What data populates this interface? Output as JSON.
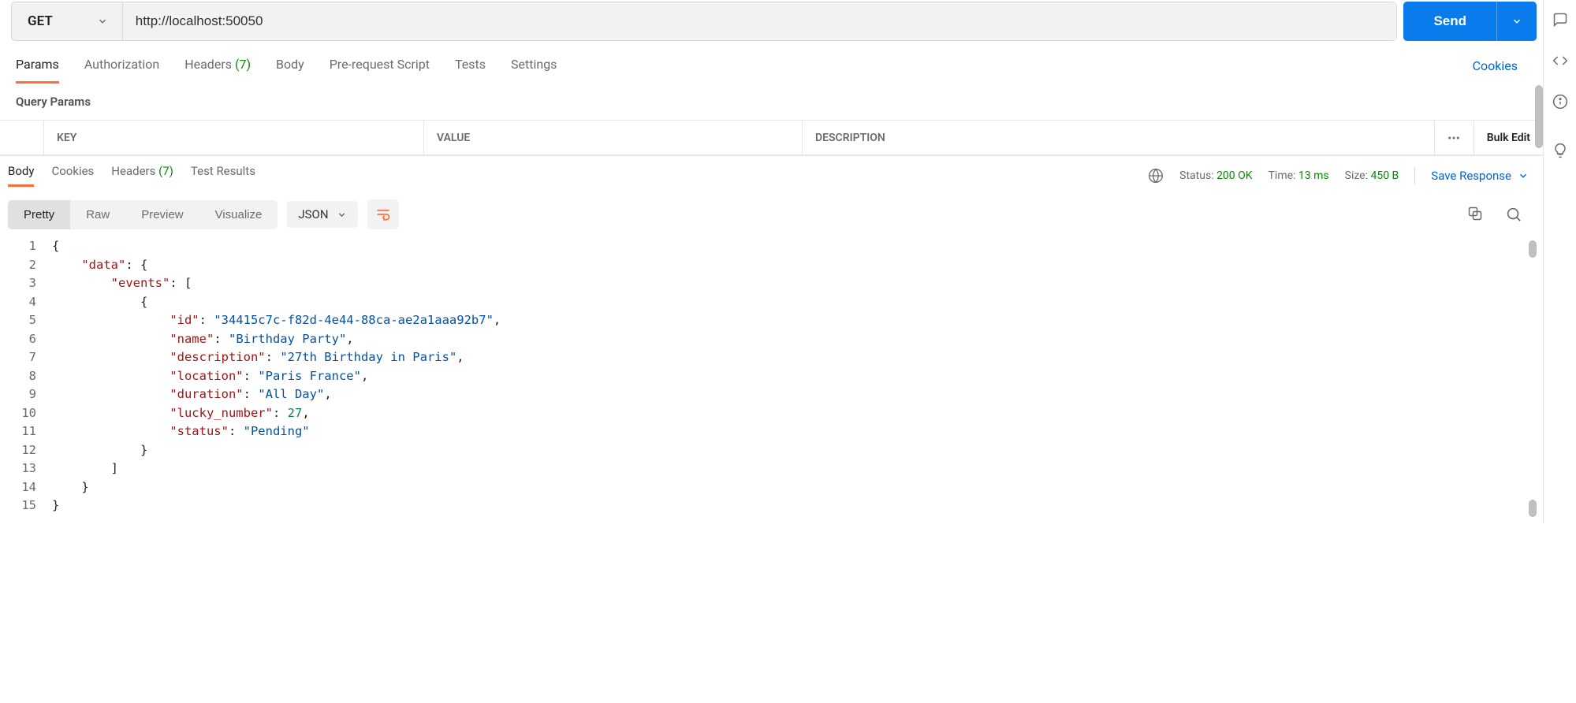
{
  "request": {
    "method": "GET",
    "url": "http://localhost:50050",
    "send_label": "Send"
  },
  "tabs": {
    "params": "Params",
    "authorization": "Authorization",
    "headers": "Headers",
    "headers_count": "(7)",
    "body": "Body",
    "prerequest": "Pre-request Script",
    "tests": "Tests",
    "settings": "Settings",
    "cookies_link": "Cookies"
  },
  "query_params": {
    "title": "Query Params",
    "columns": {
      "key": "KEY",
      "value": "VALUE",
      "description": "DESCRIPTION"
    },
    "bulk_edit": "Bulk Edit"
  },
  "response": {
    "tabs": {
      "body": "Body",
      "cookies": "Cookies",
      "headers": "Headers",
      "headers_count": "(7)",
      "test_results": "Test Results"
    },
    "status_label": "Status:",
    "status_value": "200 OK",
    "time_label": "Time:",
    "time_value": "13 ms",
    "size_label": "Size:",
    "size_value": "450 B",
    "save_response": "Save Response",
    "view_tabs": {
      "pretty": "Pretty",
      "raw": "Raw",
      "preview": "Preview",
      "visualize": "Visualize"
    },
    "format": "JSON"
  },
  "code": {
    "lines": [
      "1",
      "2",
      "3",
      "4",
      "5",
      "6",
      "7",
      "8",
      "9",
      "10",
      "11",
      "12",
      "13",
      "14",
      "15"
    ],
    "json": {
      "data_key": "\"data\"",
      "events_key": "\"events\"",
      "id_key": "\"id\"",
      "id_val": "\"34415c7c-f82d-4e44-88ca-ae2a1aaa92b7\"",
      "name_key": "\"name\"",
      "name_val": "\"Birthday Party\"",
      "desc_key": "\"description\"",
      "desc_val": "\"27th Birthday in Paris\"",
      "loc_key": "\"location\"",
      "loc_val": "\"Paris France\"",
      "dur_key": "\"duration\"",
      "dur_val": "\"All Day\"",
      "lucky_key": "\"lucky_number\"",
      "lucky_val": "27",
      "status_key": "\"status\"",
      "status_val": "\"Pending\""
    }
  }
}
